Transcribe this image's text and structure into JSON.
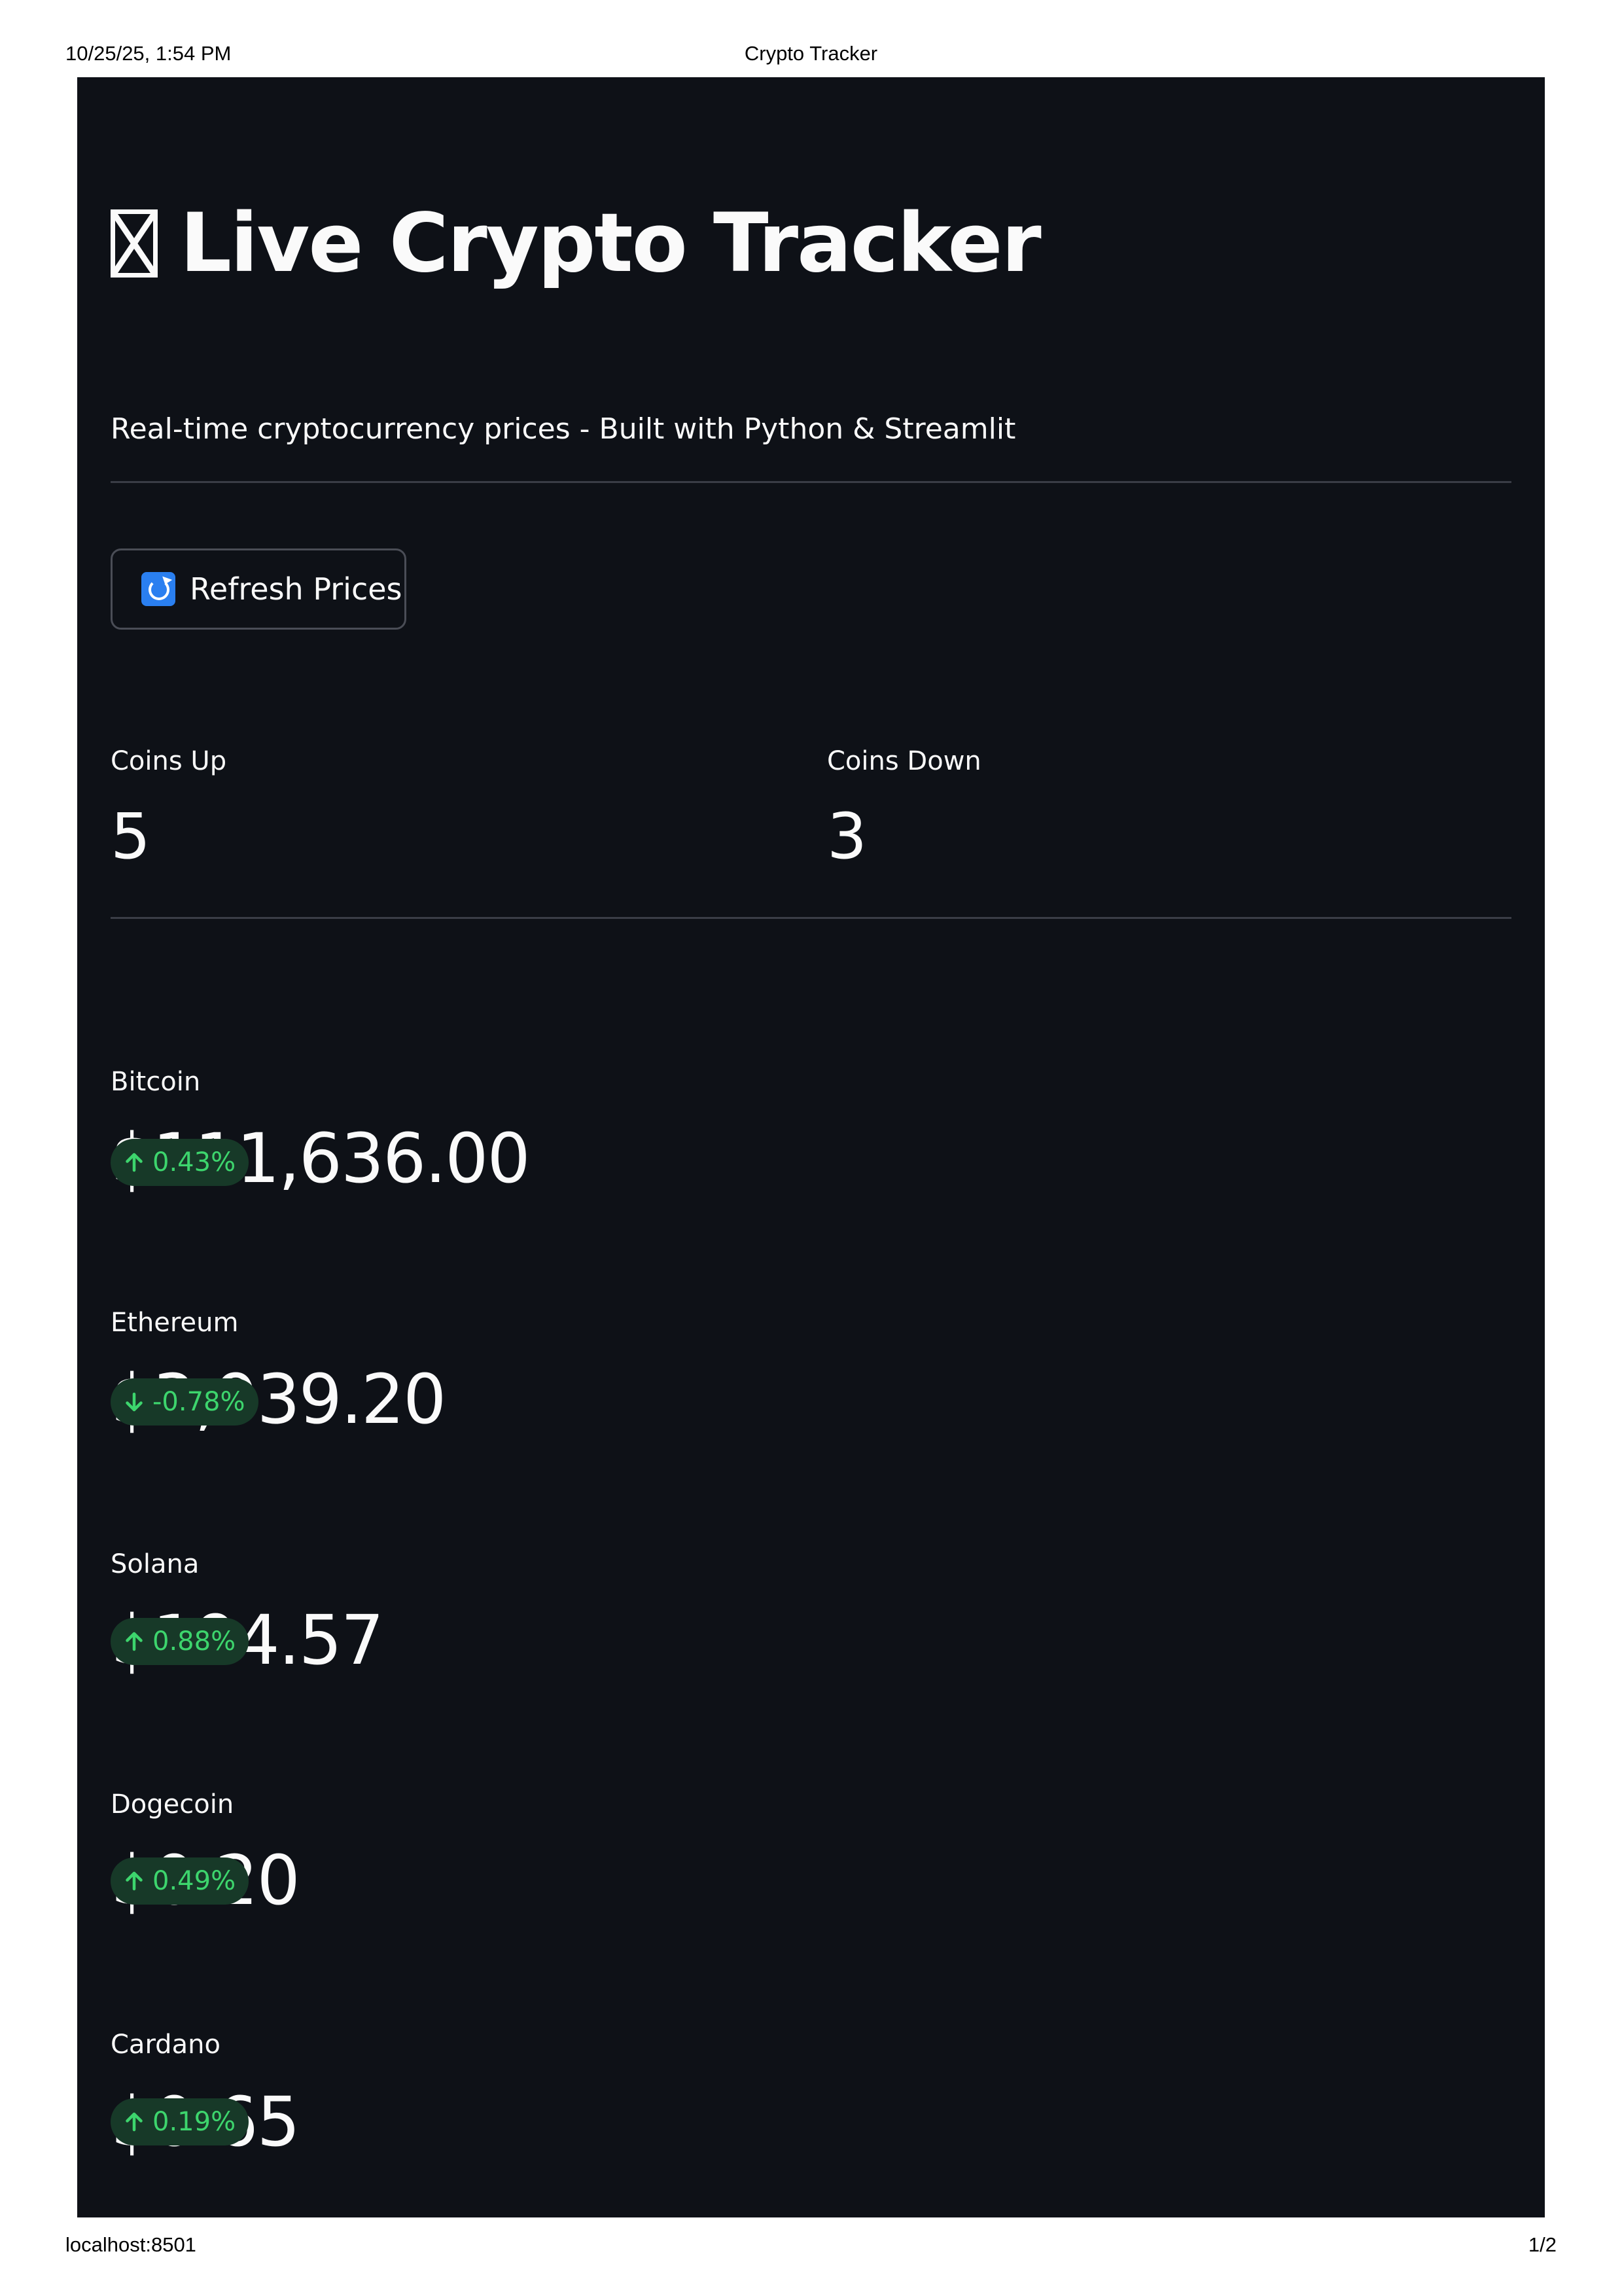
{
  "print": {
    "datetime": "10/25/25, 1:54 PM",
    "page_title": "Crypto Tracker",
    "url": "localhost:8501",
    "page_number": "1/2"
  },
  "header": {
    "title_icon": "missing-glyph-icon",
    "title": "Live Crypto Tracker",
    "subtitle": "Real-time cryptocurrency prices - Built with Python & Streamlit"
  },
  "refresh_button": {
    "icon": "refresh-icon",
    "label": "Refresh Prices"
  },
  "summary": {
    "coins_up": {
      "label": "Coins Up",
      "value": "5"
    },
    "coins_down": {
      "label": "Coins Down",
      "value": "3"
    }
  },
  "coins": [
    {
      "name": "Bitcoin",
      "price": "$111,636.00",
      "change": "0.43%",
      "direction": "up"
    },
    {
      "name": "Ethereum",
      "price": "$3,939.20",
      "change": "-0.78%",
      "direction": "down"
    },
    {
      "name": "Solana",
      "price": "$194.57",
      "change": "0.88%",
      "direction": "up"
    },
    {
      "name": "Dogecoin",
      "price": "$0.20",
      "change": "0.49%",
      "direction": "up"
    },
    {
      "name": "Cardano",
      "price": "$0.65",
      "change": "0.19%",
      "direction": "up"
    }
  ],
  "colors": {
    "background": "#0e1117",
    "text": "#fafafa",
    "delta_text": "#3dd56d",
    "delta_background": "#173928",
    "divider": "#3a3d46"
  }
}
